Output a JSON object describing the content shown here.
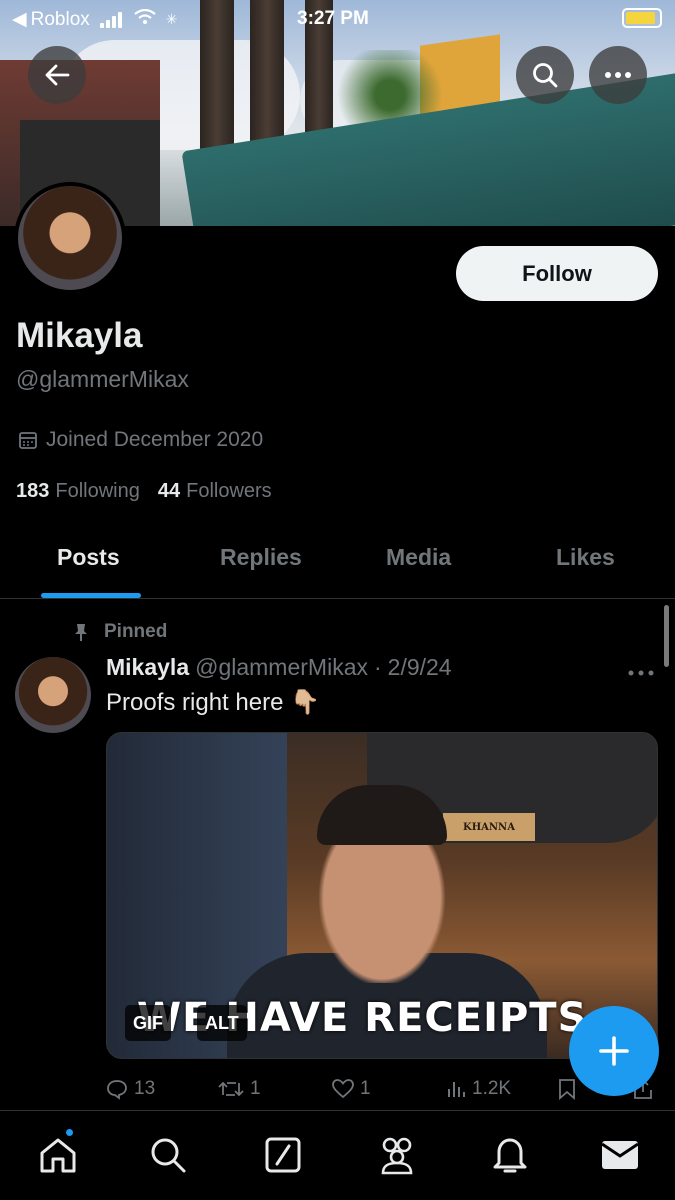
{
  "status_bar": {
    "carrier": "Roblox",
    "time": "3:27 PM",
    "battery_fraction": 0.9
  },
  "profile": {
    "follow_label": "Follow",
    "name": "Mikayla",
    "handle": "@glammerMikax",
    "joined": "Joined December 2020",
    "following_count": "183",
    "following_label": "Following",
    "followers_count": "44",
    "followers_label": "Followers"
  },
  "tabs": [
    {
      "label": "Posts",
      "active": true
    },
    {
      "label": "Replies",
      "active": false
    },
    {
      "label": "Media",
      "active": false
    },
    {
      "label": "Likes",
      "active": false
    }
  ],
  "post": {
    "pinned_label": "Pinned",
    "author": "Mikayla",
    "handle": "@glammerMikax",
    "separator": "·",
    "date": "2/9/24",
    "text": "Proofs right here 👇🏼",
    "media": {
      "caption": "WE HAVE RECEIPTS",
      "nameplate": "KHANNA",
      "gif_badge": "GIF",
      "alt_badge": "ALT"
    },
    "stats": {
      "replies": "13",
      "reposts": "1",
      "likes": "1",
      "views": "1.2K"
    }
  },
  "icons": {
    "back": "arrow-left-icon",
    "search": "search-icon",
    "more": "more-icon",
    "compose": "plus-icon",
    "home": "home-icon",
    "explore": "search-icon",
    "grok": "slash-box-icon",
    "communities": "people-icon",
    "notifications": "bell-icon",
    "messages": "envelope-icon"
  },
  "colors": {
    "accent": "#1d9bf0",
    "background": "#000000",
    "muted": "#71767b"
  }
}
